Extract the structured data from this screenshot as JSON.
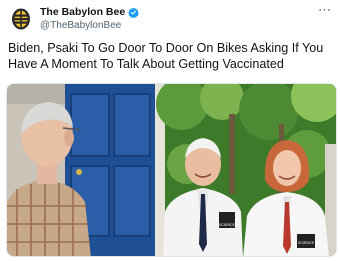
{
  "tweet": {
    "display_name": "The Babylon Bee",
    "handle": "@TheBabylonBee",
    "verified": true,
    "more_icon": "⋯",
    "text": "Biden, Psaki To Go Door To Door On Bikes Asking If You Have A Moment To Talk About Getting Vaccinated"
  },
  "media": {
    "left_badge_text": "SCIENCE",
    "right_badge_text": "SCIENCE"
  },
  "colors": {
    "verified_blue": "#1d9bf0",
    "door_blue": "#1f4f94",
    "foliage": "#3d7a2a"
  }
}
